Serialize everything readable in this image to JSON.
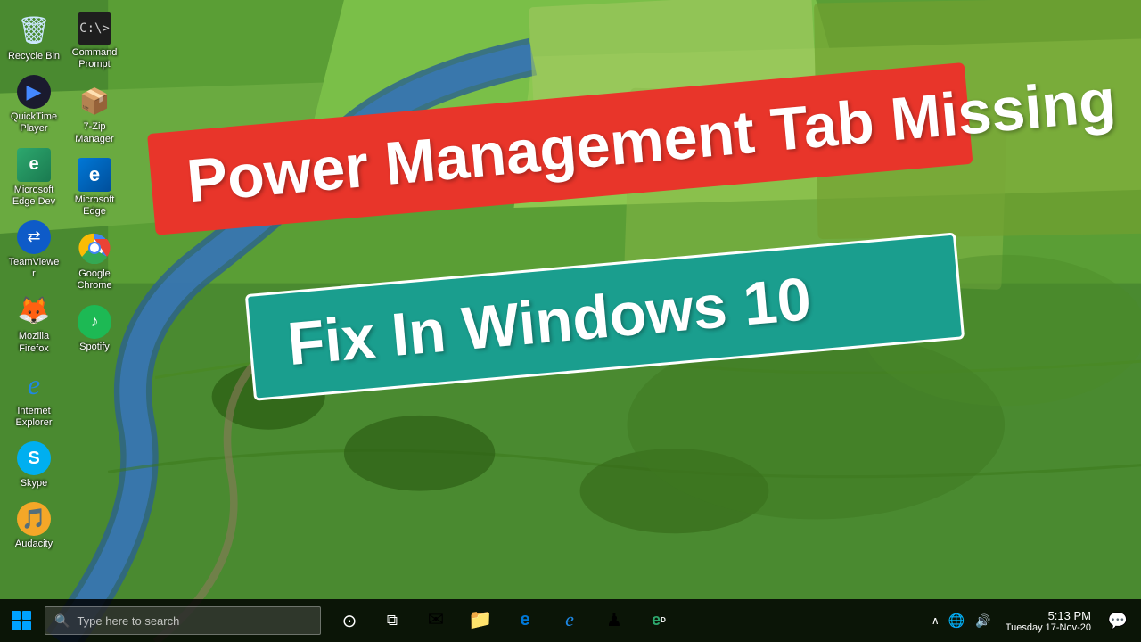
{
  "desktop": {
    "icons": [
      {
        "id": "recycle-bin",
        "label": "Recycle Bin",
        "symbol": "🗑",
        "row": 1,
        "col": 1
      },
      {
        "id": "quicktime",
        "label": "QuickTime Player",
        "symbol": "▶",
        "row": 2,
        "col": 1
      },
      {
        "id": "edge-dev",
        "label": "Microsoft Edge Dev",
        "symbol": "⊕",
        "row": 3,
        "col": 1
      },
      {
        "id": "teamviewer",
        "label": "TeamViewer",
        "symbol": "⇄",
        "row": 4,
        "col": 1
      },
      {
        "id": "firefox",
        "label": "Mozilla Firefox",
        "symbol": "🦊",
        "row": 5,
        "col": 1
      },
      {
        "id": "ie",
        "label": "Internet Explorer",
        "symbol": "ℯ",
        "row": 6,
        "col": 1
      },
      {
        "id": "skype",
        "label": "Skype",
        "symbol": "S",
        "row": 7,
        "col": 1
      },
      {
        "id": "audacity",
        "label": "Audacity",
        "symbol": "🎵",
        "row": 1,
        "col": 2
      },
      {
        "id": "cmd",
        "label": "Command Prompt",
        "symbol": "C:\\>",
        "row": 2,
        "col": 2
      },
      {
        "id": "sevenz",
        "label": "7-Zip Manager",
        "symbol": "📦",
        "row": 3,
        "col": 2
      },
      {
        "id": "msedge",
        "label": "Microsoft Edge",
        "symbol": "e",
        "row": 4,
        "col": 2
      },
      {
        "id": "chrome",
        "label": "Google Chrome",
        "symbol": "◎",
        "row": 5,
        "col": 2
      },
      {
        "id": "spotify",
        "label": "Spotify",
        "symbol": "🎧",
        "row": 6,
        "col": 2
      }
    ],
    "title_line1": "Power Management Tab Missing",
    "title_line2": "Fix In Windows 10"
  },
  "taskbar": {
    "search_placeholder": "Type here to search",
    "time": "5:13 PM",
    "date": "Tuesday 17-Nov-20",
    "apps": [
      {
        "id": "cortana",
        "symbol": "⊙",
        "label": "Cortana"
      },
      {
        "id": "task-view",
        "symbol": "⧉",
        "label": "Task View"
      },
      {
        "id": "mail",
        "symbol": "✉",
        "label": "Mail"
      },
      {
        "id": "file-explorer",
        "symbol": "📁",
        "label": "File Explorer"
      },
      {
        "id": "edge-tb",
        "symbol": "e",
        "label": "Edge"
      },
      {
        "id": "ie-tb",
        "symbol": "ℯ",
        "label": "Internet Explorer"
      },
      {
        "id": "steam",
        "symbol": "♟",
        "label": "Steam"
      },
      {
        "id": "edge-dev-tb",
        "symbol": "⊕",
        "label": "Edge Dev"
      }
    ],
    "tray": {
      "arrow_label": "Show hidden icons",
      "network_label": "Network",
      "sound_label": "Sound",
      "notification_label": "Notifications"
    }
  }
}
